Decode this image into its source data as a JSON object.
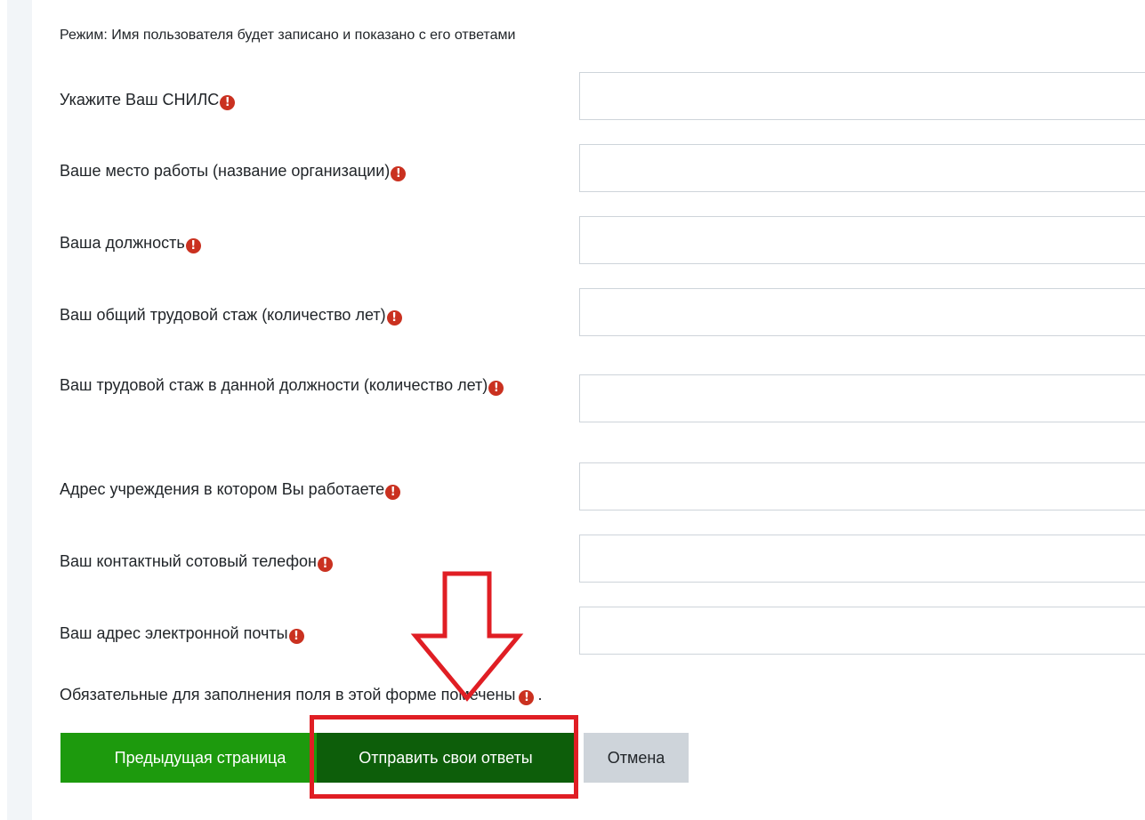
{
  "form": {
    "mode_text": "Режим: Имя пользователя будет записано и показано с его ответами",
    "fields": [
      {
        "label": "Укажите Ваш СНИЛС",
        "value": ""
      },
      {
        "label": "Ваше место работы (название организации)",
        "value": ""
      },
      {
        "label": "Ваша должность",
        "value": ""
      },
      {
        "label": "Ваш общий трудовой стаж (количество лет)",
        "value": ""
      },
      {
        "label": "Ваш трудовой стаж в данной должности (количество лет)",
        "value": ""
      },
      {
        "label": "Адрес учреждения в котором Вы работаете",
        "value": ""
      },
      {
        "label": "Ваш контактный сотовый телефон",
        "value": ""
      },
      {
        "label": "Ваш адрес электронной почты",
        "value": ""
      }
    ],
    "required_note_before": "Обязательные для заполнения поля в этой форме помечены",
    "required_note_after": ".",
    "required_marker": "!"
  },
  "buttons": {
    "prev_label": "Предыдущая страница",
    "submit_label": "Отправить свои ответы",
    "cancel_label": "Отмена"
  },
  "colors": {
    "required_icon": "#ca3120",
    "prev_button": "#1d9a0d",
    "submit_button": "#0d5e0a",
    "cancel_button": "#ced4da",
    "annotation": "#e01e24"
  },
  "annotation": {
    "arrow_icon": "down-arrow-outline",
    "highlight_target": "submit-button"
  }
}
